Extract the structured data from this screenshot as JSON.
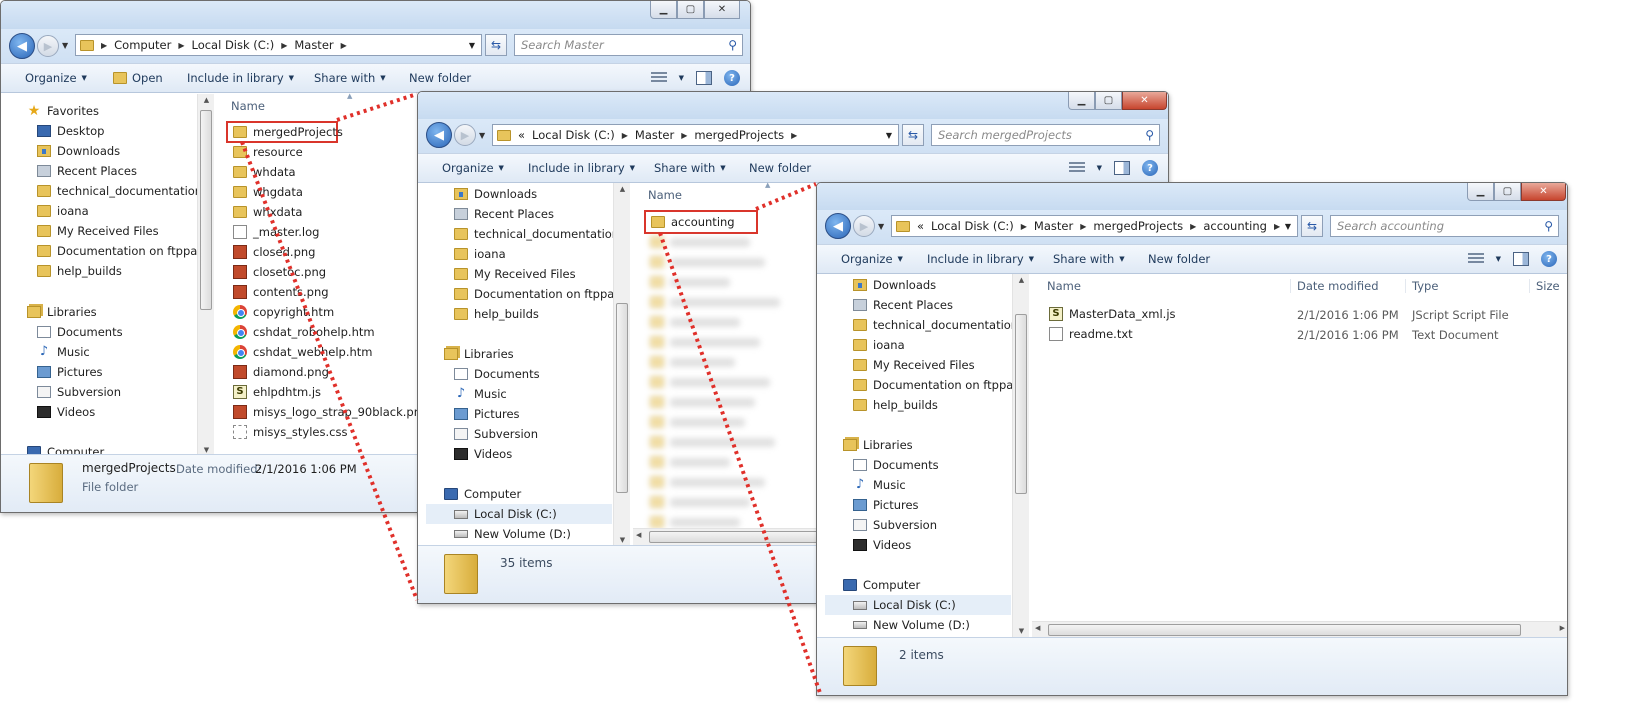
{
  "win1": {
    "path": [
      "Computer",
      "Local Disk (C:)",
      "Master"
    ],
    "search_placeholder": "Search Master",
    "toolbar": {
      "organize": "Organize",
      "open": "Open",
      "include": "Include in library",
      "share": "Share with",
      "newfolder": "New folder"
    },
    "nav": {
      "favorites": "Favorites",
      "fav_items": [
        "Desktop",
        "Downloads",
        "Recent Places",
        "technical_documentation",
        "ioana",
        "My Received Files",
        "Documentation on ftppar1",
        "help_builds"
      ],
      "libraries": "Libraries",
      "lib_items": [
        "Documents",
        "Music",
        "Pictures",
        "Subversion",
        "Videos"
      ],
      "computer": "Computer"
    },
    "col_name": "Name",
    "files": [
      "mergedProjects",
      "resource",
      "whdata",
      "whgdata",
      "whxdata",
      "_master.log",
      "closed.png",
      "closetoc.png",
      "contents.png",
      "copyright.htm",
      "cshdat_robohelp.htm",
      "cshdat_webhelp.htm",
      "diamond.png",
      "ehlpdhtm.js",
      "misys_logo_strap_90black.png",
      "misys_styles.css"
    ],
    "details": {
      "name": "mergedProjects",
      "date_label": "Date modified:",
      "date_value": "2/1/2016 1:06 PM",
      "type": "File folder"
    }
  },
  "win2": {
    "path_prefix": "«",
    "path": [
      "Local Disk (C:)",
      "Master",
      "mergedProjects"
    ],
    "search_placeholder": "Search mergedProjects",
    "toolbar": {
      "organize": "Organize",
      "include": "Include in library",
      "share": "Share with",
      "newfolder": "New folder"
    },
    "nav": {
      "fav_items": [
        "Downloads",
        "Recent Places",
        "technical_documentation",
        "ioana",
        "My Received Files",
        "Documentation on ftppar1",
        "help_builds"
      ],
      "libraries": "Libraries",
      "lib_items": [
        "Documents",
        "Music",
        "Pictures",
        "Subversion",
        "Videos"
      ],
      "computer": "Computer",
      "drives": [
        "Local Disk (C:)",
        "New Volume (D:)"
      ]
    },
    "col_name": "Name",
    "files": [
      "accounting"
    ],
    "status": "35 items"
  },
  "win3": {
    "path_prefix": "«",
    "path": [
      "Local Disk (C:)",
      "Master",
      "mergedProjects",
      "accounting"
    ],
    "search_placeholder": "Search accounting",
    "toolbar": {
      "organize": "Organize",
      "include": "Include in library",
      "share": "Share with",
      "newfolder": "New folder"
    },
    "nav": {
      "fav_items": [
        "Downloads",
        "Recent Places",
        "technical_documentation",
        "ioana",
        "My Received Files",
        "Documentation on ftppar1",
        "help_builds"
      ],
      "libraries": "Libraries",
      "lib_items": [
        "Documents",
        "Music",
        "Pictures",
        "Subversion",
        "Videos"
      ],
      "computer": "Computer",
      "drives": [
        "Local Disk (C:)",
        "New Volume (D:)"
      ]
    },
    "columns": {
      "name": "Name",
      "date": "Date modified",
      "type": "Type",
      "size": "Size"
    },
    "files": [
      {
        "name": "MasterData_xml.js",
        "date": "2/1/2016 1:06 PM",
        "type": "JScript Script File"
      },
      {
        "name": "readme.txt",
        "date": "2/1/2016 1:06 PM",
        "type": "Text Document"
      }
    ],
    "status": "2 items"
  },
  "colors": {
    "highlight": "#d9352b",
    "toolbar_text": "#1e395b",
    "folder": "#e8c45b"
  }
}
